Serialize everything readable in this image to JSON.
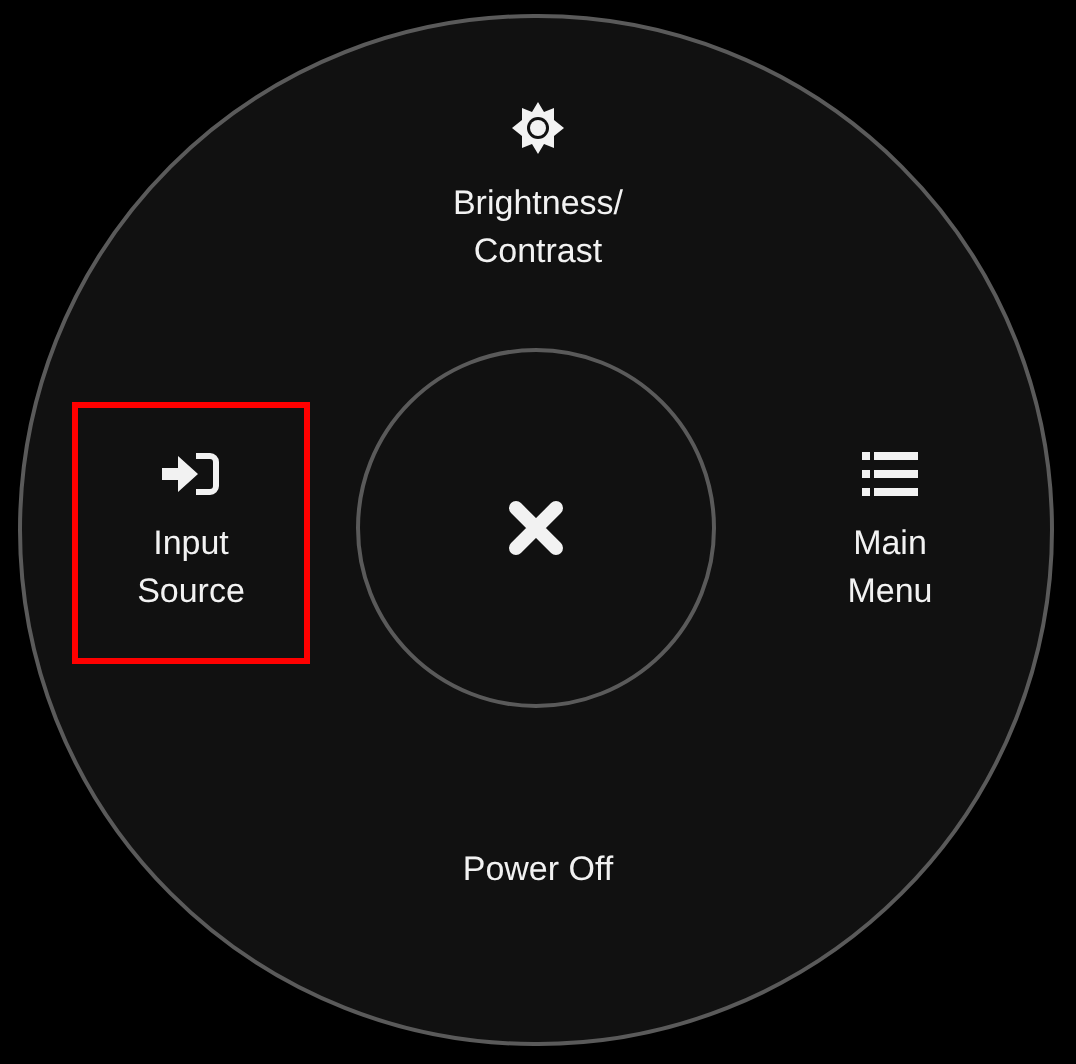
{
  "menu_items": [
    {
      "label_lines": [
        "Brightness/",
        "Contrast"
      ],
      "selected": false
    },
    {
      "label_lines": [
        "Input",
        "Source"
      ],
      "selected": true
    },
    {
      "label_lines": [
        "Main",
        "Menu"
      ],
      "selected": false
    },
    {
      "label_lines": [
        "Power Off"
      ],
      "selected": false
    }
  ]
}
